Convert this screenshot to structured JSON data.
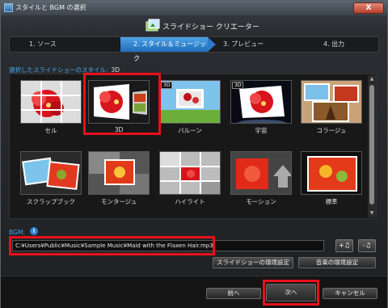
{
  "titlebar": {
    "title": "スタイルと BGM の選択",
    "close_label": "X"
  },
  "app": {
    "title": "スライドショー クリエーター"
  },
  "steps": [
    {
      "label": "1. ソース"
    },
    {
      "label": "2. スタイル＆ミュージック",
      "active": true
    },
    {
      "label": "3. プレビュー"
    },
    {
      "label": "4. 出力"
    }
  ],
  "style_section": {
    "label": "選択したスライドショーのスタイル:",
    "selected": "3D"
  },
  "styles": [
    {
      "name": "セル",
      "badge": ""
    },
    {
      "name": "3D",
      "badge": ""
    },
    {
      "name": "バルーン",
      "badge": "3D"
    },
    {
      "name": "宇宙",
      "badge": "3D"
    },
    {
      "name": "コラージュ",
      "badge": ""
    },
    {
      "name": "スクラップブック",
      "badge": ""
    },
    {
      "name": "モンタージュ",
      "badge": ""
    },
    {
      "name": "ハイライト",
      "badge": ""
    },
    {
      "name": "モーション",
      "badge": ""
    },
    {
      "name": "標準",
      "badge": ""
    }
  ],
  "bgm": {
    "label": "BGM:",
    "info_icon": "i",
    "path": "C:¥Users¥Public¥Music¥Sample Music¥Maid with the Flaxen Hair.mp3",
    "add_music_label": "+♫",
    "remove_music_label": "-♫"
  },
  "buttons": {
    "slideshow_settings": "スライドショーの環境設定",
    "music_settings": "音楽の環境設定",
    "back": "前へ",
    "next": "次へ",
    "cancel": "キャンセル"
  },
  "colors": {
    "accent": "#2a7ac8",
    "highlight": "#e8101c",
    "label_blue": "#4aa8ef"
  }
}
